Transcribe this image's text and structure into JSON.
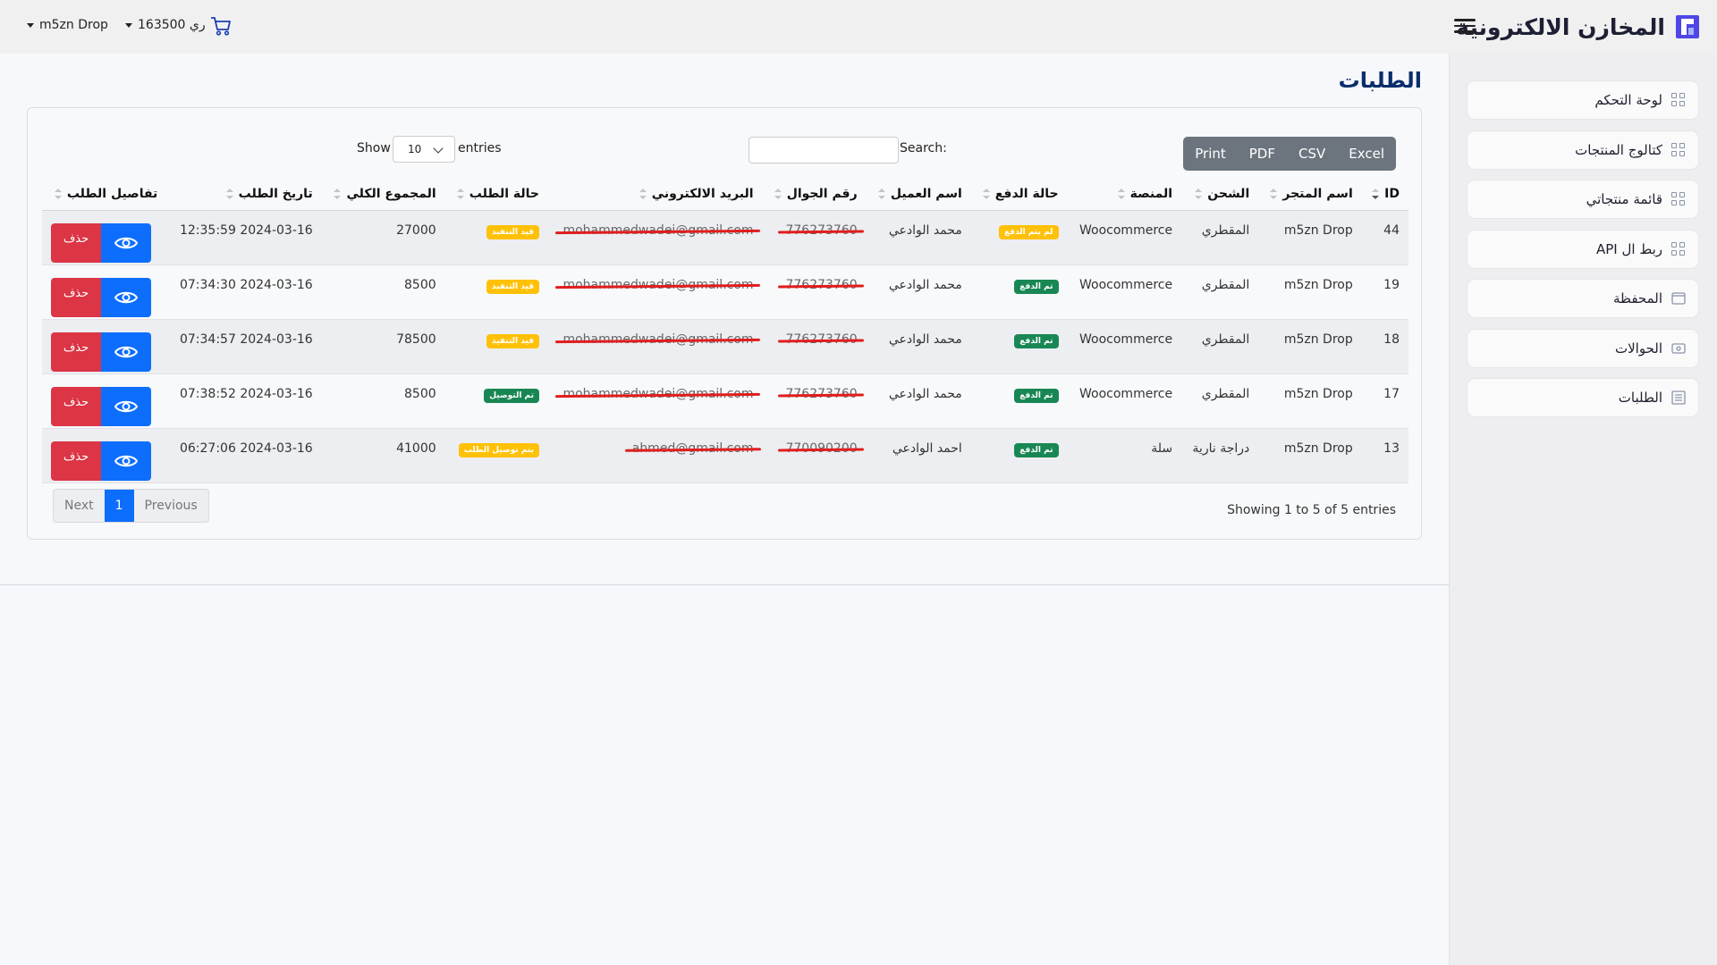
{
  "header": {
    "brand": "المخازن الالكترونية",
    "balance": "163500 ري",
    "account": "m5zn Drop"
  },
  "sidebar": {
    "items": [
      {
        "label": "لوحة التحكم",
        "icon": "grid-icon"
      },
      {
        "label": "كتالوج المنتجات",
        "icon": "grid-icon"
      },
      {
        "label": "قائمة منتجاتي",
        "icon": "grid-icon"
      },
      {
        "label": "ربط ال API",
        "icon": "grid-icon"
      },
      {
        "label": "المحفظة",
        "icon": "wallet-icon"
      },
      {
        "label": "الحوالات",
        "icon": "money-icon"
      },
      {
        "label": "الطلبات",
        "icon": "list-icon"
      }
    ]
  },
  "page": {
    "title": "الطلبات"
  },
  "toolbar": {
    "export_buttons": [
      "Excel",
      "CSV",
      "PDF",
      "Print"
    ],
    "search_label": "Search:",
    "show_label": "Show",
    "page_size": "10",
    "entries_label": "entries"
  },
  "table": {
    "headers": [
      "ID",
      "اسم المتجر",
      "الشحن",
      "المنصة",
      "حالة الدفع",
      "اسم العميل",
      "رقم الجوال",
      "البريد الالكتروني",
      "حالة الطلب",
      "المجموع الكلي",
      "تاريخ الطلب",
      "تفاصيل الطلب"
    ],
    "rows": [
      {
        "id": "44",
        "store": "m5zn Drop",
        "shipping": "المقطري",
        "platform": "Woocommerce",
        "payment": "لم يتم الدفع",
        "customer": "محمد الوادعي",
        "phone": "776273760",
        "email": "mohammedwadei@gmail.com",
        "status": "قيد التنفيذ",
        "total": "27000",
        "date": "2024-03-16 12:35:59",
        "delete": "حذف"
      },
      {
        "id": "19",
        "store": "m5zn Drop",
        "shipping": "المقطري",
        "platform": "Woocommerce",
        "payment": "تم الدفع",
        "customer": "محمد الوادعي",
        "phone": "776273760",
        "email": "mohammedwadei@gmail.com",
        "status": "قيد التنفيذ",
        "total": "8500",
        "date": "2024-03-16 07:34:30",
        "delete": "حذف"
      },
      {
        "id": "18",
        "store": "m5zn Drop",
        "shipping": "المقطري",
        "platform": "Woocommerce",
        "payment": "تم الدفع",
        "customer": "محمد الوادعي",
        "phone": "776273760",
        "email": "mohammedwadei@gmail.com",
        "status": "قيد التنفيذ",
        "total": "78500",
        "date": "2024-03-16 07:34:57",
        "delete": "حذف"
      },
      {
        "id": "17",
        "store": "m5zn Drop",
        "shipping": "المقطري",
        "platform": "Woocommerce",
        "payment": "تم الدفع",
        "customer": "محمد الوادعي",
        "phone": "776273760",
        "email": "mohammedwadei@gmail.com",
        "status": "تم التوصيل",
        "total": "8500",
        "date": "2024-03-16 07:38:52",
        "delete": "حذف"
      },
      {
        "id": "13",
        "store": "m5zn Drop",
        "shipping": "دراجة نارية",
        "platform": "سلة",
        "payment": "تم الدفع",
        "customer": "احمد الوادعي",
        "phone": "770090200",
        "email": "ahmed@gmail.com",
        "status": "يتم توصيل الطلب",
        "total": "41000",
        "date": "2024-03-16 06:27:06",
        "delete": "حذف"
      }
    ]
  },
  "footer": {
    "showing": "Showing 1 to 5 of 5 entries",
    "pager": [
      "Previous",
      "1",
      "Next"
    ]
  },
  "colors": {
    "primary": "#0d6efd",
    "danger": "#dc3545",
    "warning": "#ffc107",
    "success": "#198754",
    "title": "#0b2d6b"
  }
}
